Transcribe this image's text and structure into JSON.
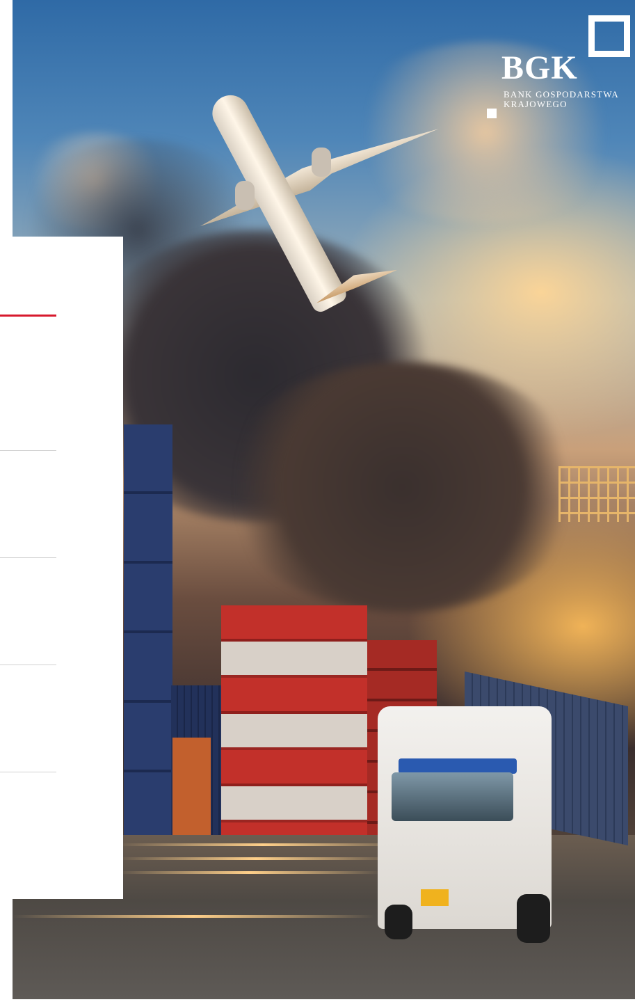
{
  "logo": {
    "abbreviation": "BGK",
    "line1": "BANK GOSPODARSTWA",
    "line2": "KRAJOWEGO"
  },
  "colors": {
    "accent_rule": "#d7192d",
    "divider_rule": "#d0d0d0",
    "panel": "#ffffff"
  },
  "photo": {
    "subject": "cargo-plane-containers-truck-sunset"
  }
}
